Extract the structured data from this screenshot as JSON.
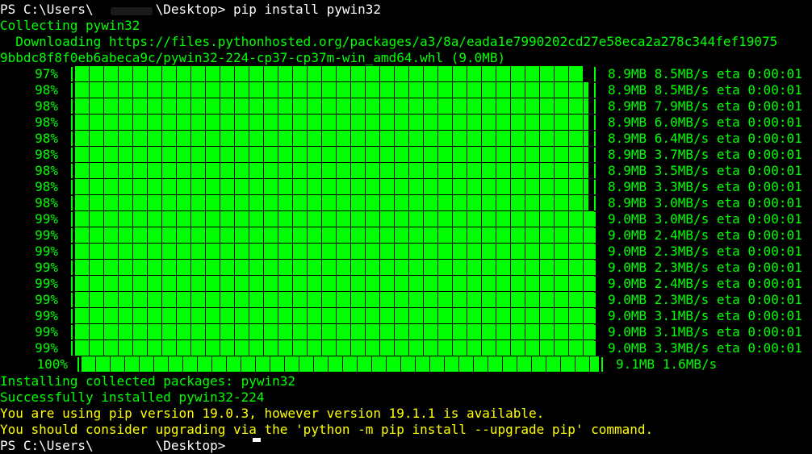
{
  "terminal": {
    "prompt_line": "PS C:\\Users\\        \\Desktop> pip install pywin32",
    "collecting": "Collecting pywin32",
    "downloading_1": "  Downloading https://files.pythonhosted.org/packages/a3/8a/eada1e7990202cd27e58eca2a278c344fef19075",
    "downloading_2": "9bbdc8f8f0eb6abeca9c/pywin32-224-cp37-cp37m-win_amd64.whl (9.0MB)",
    "installing": "Installing collected packages: pywin32",
    "success": "Successfully installed pywin32-224",
    "warning_1": "You are using pip version 19.0.3, however version 19.1.1 is available.",
    "warning_2": "You should consider upgrading via the 'python -m pip install --upgrade pip' command.",
    "last_prompt": "PS C:\\Users\\        \\Desktop> "
  },
  "progress_rows": [
    {
      "percent": "97%",
      "stats": "8.9MB 8.5MB/s eta 0:00:01",
      "fill": 0.97
    },
    {
      "percent": "98%",
      "stats": "8.9MB 8.5MB/s eta 0:00:01",
      "fill": 0.98
    },
    {
      "percent": "98%",
      "stats": "8.9MB 7.9MB/s eta 0:00:01",
      "fill": 0.98
    },
    {
      "percent": "98%",
      "stats": "8.9MB 6.0MB/s eta 0:00:01",
      "fill": 0.98
    },
    {
      "percent": "98%",
      "stats": "8.9MB 6.4MB/s eta 0:00:01",
      "fill": 0.98
    },
    {
      "percent": "98%",
      "stats": "8.9MB 3.7MB/s eta 0:00:01",
      "fill": 0.98
    },
    {
      "percent": "98%",
      "stats": "8.9MB 3.5MB/s eta 0:00:01",
      "fill": 0.98
    },
    {
      "percent": "98%",
      "stats": "8.9MB 3.3MB/s eta 0:00:01",
      "fill": 0.98
    },
    {
      "percent": "98%",
      "stats": "8.9MB 3.0MB/s eta 0:00:01",
      "fill": 0.98
    },
    {
      "percent": "99%",
      "stats": "9.0MB 3.0MB/s eta 0:00:01",
      "fill": 0.99
    },
    {
      "percent": "99%",
      "stats": "9.0MB 2.4MB/s eta 0:00:01",
      "fill": 0.99
    },
    {
      "percent": "99%",
      "stats": "9.0MB 2.3MB/s eta 0:00:01",
      "fill": 0.99
    },
    {
      "percent": "99%",
      "stats": "9.0MB 2.3MB/s eta 0:00:01",
      "fill": 0.99
    },
    {
      "percent": "99%",
      "stats": "9.0MB 2.4MB/s eta 0:00:01",
      "fill": 0.99
    },
    {
      "percent": "99%",
      "stats": "9.0MB 2.3MB/s eta 0:00:01",
      "fill": 0.99
    },
    {
      "percent": "99%",
      "stats": "9.0MB 3.1MB/s eta 0:00:01",
      "fill": 0.99
    },
    {
      "percent": "99%",
      "stats": "9.0MB 3.1MB/s eta 0:00:01",
      "fill": 0.99
    },
    {
      "percent": "99%",
      "stats": "9.0MB 3.3MB/s eta 0:00:01",
      "fill": 0.99
    }
  ],
  "final_row": {
    "percent": "100%",
    "stats": "9.1MB 1.6MB/s",
    "fill": 1.0
  },
  "colors": {
    "background": "#000000",
    "text_green": "#00ff00",
    "text_yellow": "#ffff00",
    "prompt_white": "#ffffff"
  }
}
